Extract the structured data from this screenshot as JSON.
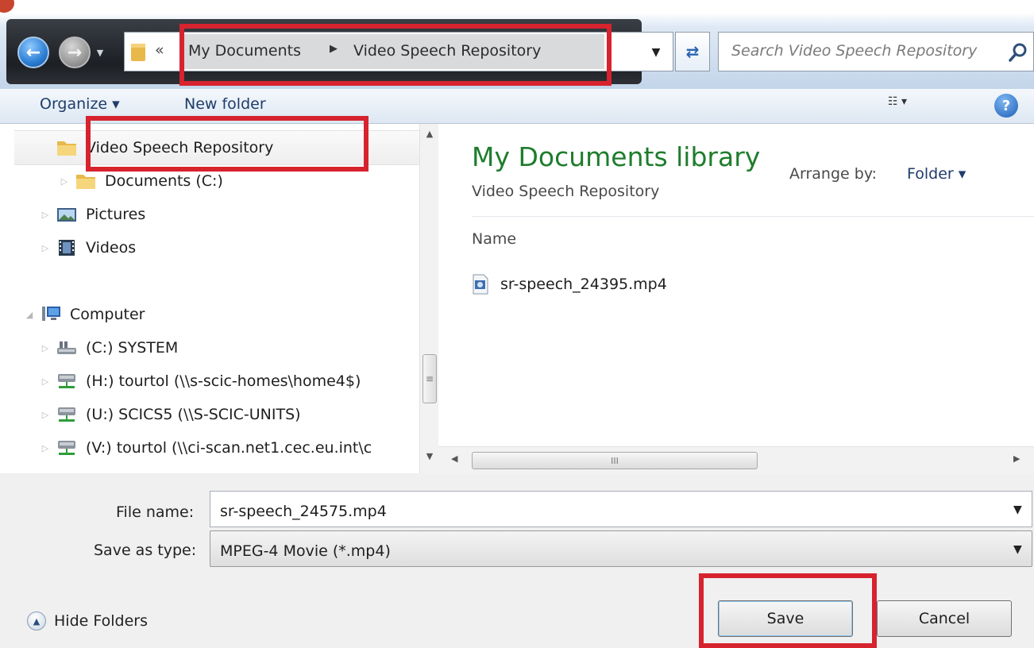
{
  "address": {
    "overflow_glyph": "«",
    "crumbs": [
      "My Documents",
      "Video Speech Repository"
    ],
    "crumb_separator": "▶",
    "dropdown_glyph": "▼",
    "refresh_glyph": "⇄"
  },
  "search": {
    "placeholder": "Search Video Speech Repository"
  },
  "toolbar": {
    "organize_label": "Organize ▾",
    "new_folder_label": "New folder",
    "view_glyph": "☷ ▾",
    "help_glyph": "?"
  },
  "nav": {
    "items": [
      {
        "label": "Video Speech Repository",
        "icon": "folder-icon"
      },
      {
        "label": "Documents (C:)",
        "icon": "folder-icon"
      },
      {
        "label": "Pictures",
        "icon": "pictures-icon"
      },
      {
        "label": "Videos",
        "icon": "videos-icon"
      },
      {
        "label": "Computer",
        "icon": "computer-icon"
      },
      {
        "label": "(C:) SYSTEM",
        "icon": "drive-icon"
      },
      {
        "label": "(H:) tourtol (\\\\s-scic-homes\\home4$)",
        "icon": "network-drive-icon"
      },
      {
        "label": "(U:) SCICS5 (\\\\S-SCIC-UNITS)",
        "icon": "network-drive-icon"
      },
      {
        "label": "(V:) tourtol (\\\\ci-scan.net1.cec.eu.int\\c",
        "icon": "network-drive-icon"
      }
    ],
    "expander_collapsed": "▷",
    "expander_open": "◢"
  },
  "content": {
    "library_title": "My Documents library",
    "library_subtitle": "Video Speech Repository",
    "arrange_label": "Arrange by:",
    "arrange_value": "Folder ▾",
    "column_name": "Name",
    "files": [
      "sr-speech_24395.mp4"
    ],
    "hscroll_grip": "III"
  },
  "form": {
    "file_name_label": "File name:",
    "file_name_value": "sr-speech_24575.mp4",
    "save_as_label": "Save as type:",
    "save_as_value": "MPEG-4 Movie (*.mp4)",
    "hide_folders_label": "Hide Folders",
    "save_label": "Save",
    "cancel_label": "Cancel"
  },
  "colors": {
    "annotation_red": "#d6232e",
    "library_green": "#1e7d2c",
    "link_blue": "#1e3d6b"
  }
}
